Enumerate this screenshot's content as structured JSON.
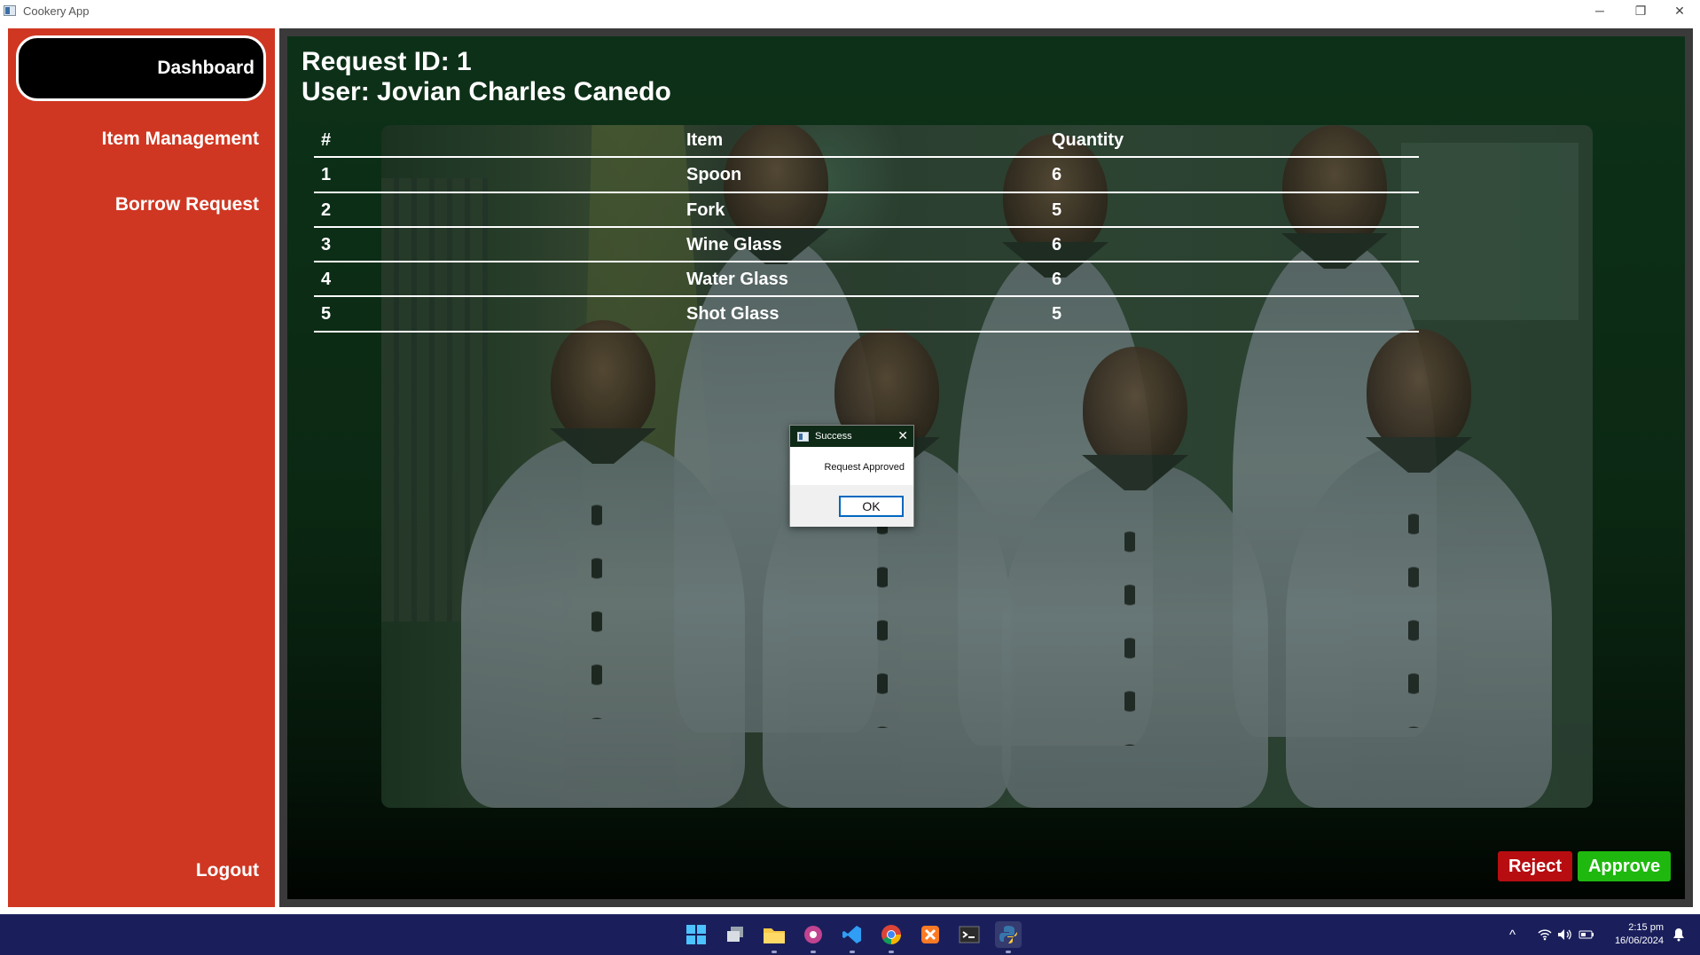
{
  "window": {
    "title": "Cookery App",
    "minimize_glyph": "─",
    "maximize_glyph": "❐",
    "close_glyph": "✕"
  },
  "sidebar": {
    "items": [
      {
        "label": "Dashboard",
        "active": true
      },
      {
        "label": "Item Management",
        "active": false
      },
      {
        "label": "Borrow Request",
        "active": false
      }
    ],
    "logout_label": "Logout",
    "color": "#cf3722"
  },
  "request": {
    "id_line": "Request ID: 1",
    "user_line": "User: Jovian Charles Canedo"
  },
  "table": {
    "headers": [
      "#",
      "Item",
      "Quantity"
    ],
    "rows": [
      [
        "1",
        "Spoon",
        "6"
      ],
      [
        "2",
        "Fork",
        "5"
      ],
      [
        "3",
        "Wine Glass",
        "6"
      ],
      [
        "4",
        "Water Glass",
        "6"
      ],
      [
        "5",
        "Shot Glass",
        "5"
      ]
    ]
  },
  "dialog": {
    "title": "Success",
    "message": "Request Approved",
    "ok_label": "OK",
    "close_glyph": "✕"
  },
  "actions": {
    "reject_label": "Reject",
    "approve_label": "Approve",
    "reject_color": "#b70d11",
    "approve_color": "#1fb80f"
  },
  "taskbar": {
    "icons": [
      "windows-start-icon",
      "task-view-icon",
      "file-explorer-icon",
      "app-icon",
      "vscode-icon",
      "chrome-icon",
      "xampp-icon",
      "terminal-icon",
      "python-icon"
    ],
    "tray_chevron": "^",
    "time": "2:15 pm",
    "date": "16/06/2024"
  }
}
